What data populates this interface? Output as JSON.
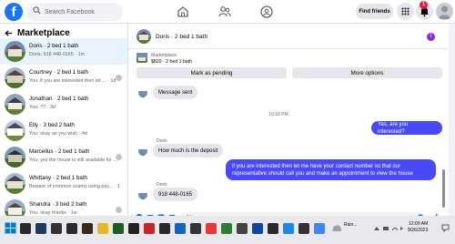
{
  "topbar": {
    "logo": "f",
    "search_placeholder": "Search Facebook",
    "find_friends": "Find friends",
    "notification_count": "1"
  },
  "marketplace": {
    "title": "Marketplace",
    "items": [
      {
        "name": "Doris · 2 bed 1 bath",
        "snippet": "Doris: 918 448-0165 · 1m",
        "active": true
      },
      {
        "name": "Courtney · 2 bed 1 bath",
        "snippet": "You: if you are interested then let ... · 1d"
      },
      {
        "name": "Jonathan · 2 bed 1 bath",
        "snippet": "You: ?? · 3d"
      },
      {
        "name": "Elly · 3 bed 2 bath",
        "snippet": "You: okay as you wish · 4d"
      },
      {
        "name": "Marcellus · 2 bed 1 bath",
        "snippet": "You: yes the house is still available for ... · 6d"
      },
      {
        "name": "Whittany · 2 bed 1 bath",
        "snippet": "Beware of common scams using pay... · 1w"
      },
      {
        "name": "Shandra · 3 bed 2 bath",
        "snippet": "You: okay thanks · 1w"
      }
    ]
  },
  "chat": {
    "header_name": "Doris · 2 bed 1 bath",
    "info_icon": "i",
    "listing_name": "Marketplace",
    "listing_price": "$820 · 2 bed 1 bath",
    "mark_pending": "Mark as pending",
    "more_options": "More options",
    "messages": {
      "msg1": "Message sent",
      "time": "10:18 PM",
      "out1": "Yes, are you interested?",
      "sender1": "Doris",
      "in1": "How much is the deposit",
      "out2": "if you are interested then let me have your contact number so that our representative should call you and make an appointment to view the house",
      "sender2": "Doris",
      "in2": "918 448-0165"
    },
    "composer_placeholder": "Aa"
  },
  "taskbar": {
    "weather_label": "Rain...",
    "time": "12:09 AM",
    "date": "9/26/2023"
  }
}
